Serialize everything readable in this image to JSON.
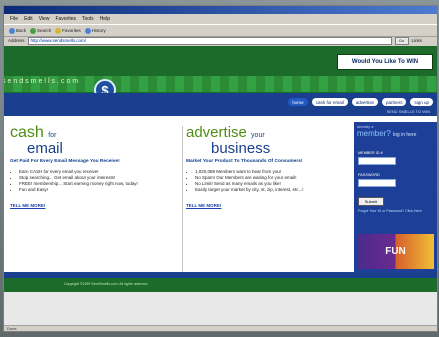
{
  "browser": {
    "menu": [
      "File",
      "Edit",
      "View",
      "Favorites",
      "Tools",
      "Help"
    ],
    "toolbar": [
      "Back",
      "Search",
      "Favorites",
      "History"
    ],
    "address_label": "Address",
    "url": "http://www.sendsmells.com/",
    "go": "Go",
    "links": "Links"
  },
  "site": {
    "banner": "Would You Like To WIN",
    "logo": "sendsmells.com",
    "nav": [
      "home",
      "cash for email",
      "advertise",
      "partners",
      "sign up"
    ],
    "tagline": "SEND SMELLS TO WIN",
    "cash": {
      "logo_1": "cash",
      "logo_2": "for",
      "logo_3": "email",
      "headline": "Get Paid For Every Email Message You Receive!",
      "bullets": [
        "Earn CASH for every email you receive!",
        "Stop searching... Get email about your interests!",
        "FREE! membership... Start earning money right now, today!",
        "Fun and Easy!"
      ],
      "link": "TELL ME MORE!"
    },
    "business": {
      "logo_1": "advertise",
      "logo_2": "your",
      "logo_3": "business",
      "headline": "Market Your Product To Thousands Of Consumers!",
      "bullets": [
        "1,020,089 Members want to hear from you!",
        "No Spam! Our Members are waiting for your email!",
        "No Limit! Send as many emails as you like!",
        "Easily target your market by city, st, zip, interest, etc...!"
      ],
      "link": "TELL ME MORE!"
    },
    "sidebar": {
      "already": "already a",
      "member": "member?",
      "login": "log in here",
      "member_id": "MEMBER ID #",
      "password": "PASSWORD",
      "submit": "Submit",
      "forgot": "Forgot Your ID or Password? Click Here",
      "fun": "FUN"
    },
    "footer": "Copyright ©1999 SendSmells.com. All rights reserved."
  },
  "status": "Done"
}
